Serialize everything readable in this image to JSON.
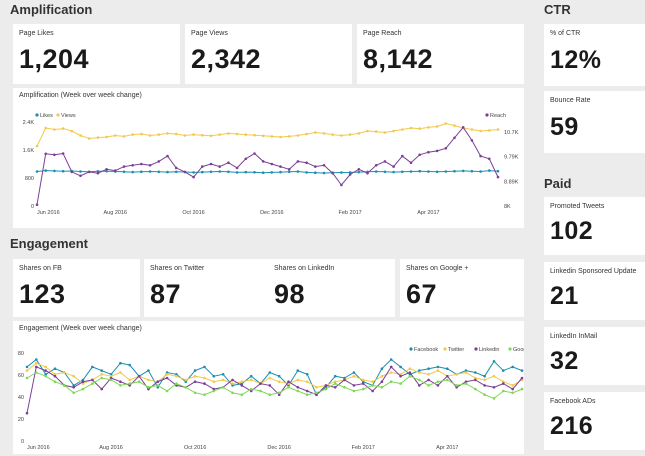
{
  "sections": {
    "amplification": "Amplification",
    "engagement": "Engagement",
    "ctr": "CTR",
    "paid": "Paid"
  },
  "amplification_stats": [
    {
      "label": "Page Likes",
      "value": "1,204"
    },
    {
      "label": "Page Views",
      "value": "2,342"
    },
    {
      "label": "Page Reach",
      "value": "8,142"
    }
  ],
  "engagement_stats": [
    {
      "label": "Shares on FB",
      "value": "123"
    },
    {
      "label": "Shares on Twitter",
      "value": "87"
    },
    {
      "label": "Shares on LinkedIn",
      "value": "98"
    },
    {
      "label": "Shares on Google +",
      "value": "67"
    }
  ],
  "ctr_stats": [
    {
      "label": "% of CTR",
      "value": "12%"
    },
    {
      "label": "Bounce Rate",
      "value": "59"
    }
  ],
  "paid_stats": [
    {
      "label": "Promoted Tweets",
      "value": "102"
    },
    {
      "label": "Linkedin Sponsored Update",
      "value": "21"
    },
    {
      "label": "LinkedIn InMail",
      "value": "32"
    },
    {
      "label": "Facebook ADs",
      "value": "216"
    }
  ],
  "colors": {
    "facebook": "#1a8fb0",
    "twitter": "#f2c94c",
    "linkedin": "#7b3f98",
    "google": "#7ed957"
  },
  "chart_data": [
    {
      "type": "line",
      "title": "Amplification (Week over week change)",
      "x_ticks": [
        "Jun 2016",
        "Aug 2016",
        "Oct 2016",
        "Dec 2016",
        "Feb 2017",
        "Apr 2017"
      ],
      "x_count": 54,
      "y_ticks": [
        "0",
        "800",
        "1.6K",
        "2.4K"
      ],
      "y_right_ticks": [
        "10.7K",
        "9.79K",
        "8.89K",
        "8K"
      ],
      "ylim": [
        0,
        2800
      ],
      "y_right_lim": [
        8000,
        11200
      ],
      "legend": [
        "Likes",
        "Views"
      ],
      "legend_right": [
        "Reach"
      ],
      "series": [
        {
          "name": "Likes",
          "color": "#1a8fb0",
          "axis": "left",
          "values": [
            1150,
            1180,
            1170,
            1160,
            1165,
            1150,
            1140,
            1155,
            1160,
            1150,
            1140,
            1130,
            1145,
            1150,
            1140,
            1130,
            1140,
            1135,
            1120,
            1130,
            1140,
            1150,
            1140,
            1120,
            1130,
            1125,
            1110,
            1120,
            1130,
            1140,
            1150,
            1120,
            1110,
            1100,
            1110,
            1115,
            1120,
            1130,
            1140,
            1150,
            1140,
            1130,
            1140,
            1150,
            1160,
            1150,
            1140,
            1150,
            1160,
            1170,
            1160,
            1150,
            1180,
            1160
          ]
        },
        {
          "name": "Views",
          "color": "#f2c94c",
          "axis": "left",
          "values": [
            2000,
            2600,
            2550,
            2580,
            2500,
            2350,
            2250,
            2280,
            2300,
            2350,
            2320,
            2380,
            2400,
            2350,
            2380,
            2420,
            2400,
            2350,
            2380,
            2360,
            2340,
            2380,
            2420,
            2400,
            2380,
            2360,
            2340,
            2320,
            2300,
            2320,
            2350,
            2400,
            2450,
            2420,
            2380,
            2350,
            2380,
            2420,
            2500,
            2480,
            2450,
            2500,
            2550,
            2600,
            2580,
            2620,
            2650,
            2750,
            2680,
            2600,
            2550,
            2500,
            2520,
            2550
          ]
        },
        {
          "name": "Reach",
          "color": "#7b3f98",
          "axis": "right",
          "values": [
            8050,
            9990,
            9950,
            10000,
            9300,
            9150,
            9300,
            9250,
            9400,
            9350,
            9500,
            9550,
            9600,
            9550,
            9700,
            9900,
            9450,
            9300,
            9100,
            9500,
            9600,
            9500,
            9650,
            9450,
            9800,
            10000,
            9700,
            9600,
            9500,
            9400,
            9700,
            9650,
            9500,
            9550,
            9250,
            8800,
            9200,
            9400,
            9250,
            9550,
            9700,
            9500,
            9900,
            9650,
            9950,
            10050,
            10100,
            10200,
            10600,
            11000,
            10500,
            9900,
            9800,
            9100
          ]
        }
      ]
    },
    {
      "type": "line",
      "title": "Engagement (Week over week change)",
      "x_ticks": [
        "Jun 2016",
        "Aug 2016",
        "Oct 2016",
        "Dec 2016",
        "Feb 2017",
        "Apr 2017"
      ],
      "x_count": 54,
      "y_ticks": [
        "0",
        "20",
        "40",
        "60",
        "80"
      ],
      "ylim": [
        0,
        95
      ],
      "legend": [
        "Facebook",
        "Twitter",
        "Linkedin",
        "Google+"
      ],
      "series": [
        {
          "name": "Facebook",
          "color": "#1a8fb0",
          "values": [
            80,
            88,
            72,
            78,
            74,
            60,
            66,
            80,
            76,
            72,
            84,
            82,
            70,
            76,
            58,
            74,
            72,
            64,
            76,
            80,
            70,
            72,
            60,
            62,
            70,
            62,
            74,
            70,
            60,
            76,
            72,
            50,
            58,
            70,
            68,
            74,
            64,
            60,
            78,
            88,
            80,
            72,
            76,
            78,
            80,
            78,
            72,
            76,
            74,
            70,
            86,
            76,
            80,
            76
          ]
        },
        {
          "name": "Twitter",
          "color": "#f2c94c",
          "values": [
            76,
            84,
            80,
            72,
            74,
            70,
            62,
            66,
            72,
            70,
            74,
            66,
            70,
            66,
            64,
            72,
            70,
            66,
            70,
            68,
            64,
            66,
            62,
            64,
            66,
            62,
            68,
            64,
            62,
            66,
            64,
            58,
            60,
            64,
            66,
            70,
            66,
            64,
            70,
            74,
            72,
            78,
            74,
            72,
            76,
            70,
            72,
            74,
            68,
            66,
            70,
            64,
            60,
            66
          ]
        },
        {
          "name": "Linkedin",
          "color": "#7b3f98",
          "values": [
            30,
            80,
            76,
            70,
            60,
            58,
            64,
            66,
            56,
            68,
            64,
            60,
            70,
            56,
            64,
            68,
            60,
            58,
            64,
            62,
            56,
            58,
            66,
            60,
            54,
            62,
            60,
            50,
            64,
            58,
            54,
            50,
            60,
            58,
            66,
            60,
            62,
            54,
            64,
            80,
            70,
            74,
            60,
            66,
            60,
            70,
            58,
            64,
            66,
            60,
            58,
            62,
            56,
            68
          ]
        },
        {
          "name": "Google+",
          "color": "#7ed957",
          "values": [
            68,
            74,
            70,
            64,
            60,
            52,
            56,
            62,
            68,
            66,
            60,
            62,
            64,
            58,
            60,
            54,
            62,
            58,
            52,
            50,
            54,
            58,
            52,
            50,
            56,
            54,
            50,
            52,
            58,
            54,
            50,
            52,
            56,
            62,
            58,
            54,
            56,
            60,
            58,
            64,
            62,
            70,
            66,
            60,
            64,
            66,
            60,
            62,
            56,
            50,
            46,
            54,
            52,
            56
          ]
        }
      ]
    }
  ]
}
